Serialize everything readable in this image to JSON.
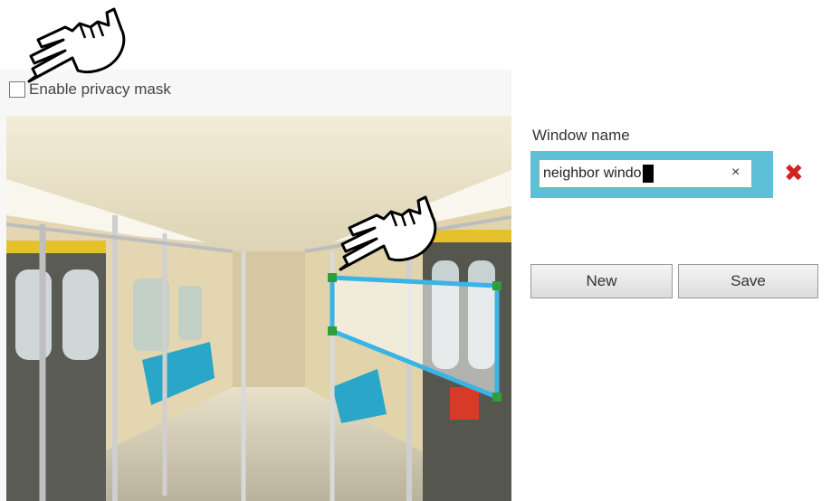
{
  "mask": {
    "label": "Enable privacy mask",
    "checked": false
  },
  "editor": {
    "window_name_label": "Window name",
    "window_name_value": "neighbor windo",
    "clear_symbol": "×",
    "delete_symbol": "✖",
    "new_label": "New",
    "save_label": "Save"
  },
  "colors": {
    "accent": "#5ec0d6",
    "mask_outline": "#39b4e6",
    "handle": "#2e9e3a",
    "delete": "#d62020"
  },
  "icons": [
    "pointing-hand-icon",
    "checkbox",
    "clear-icon",
    "delete-icon"
  ]
}
